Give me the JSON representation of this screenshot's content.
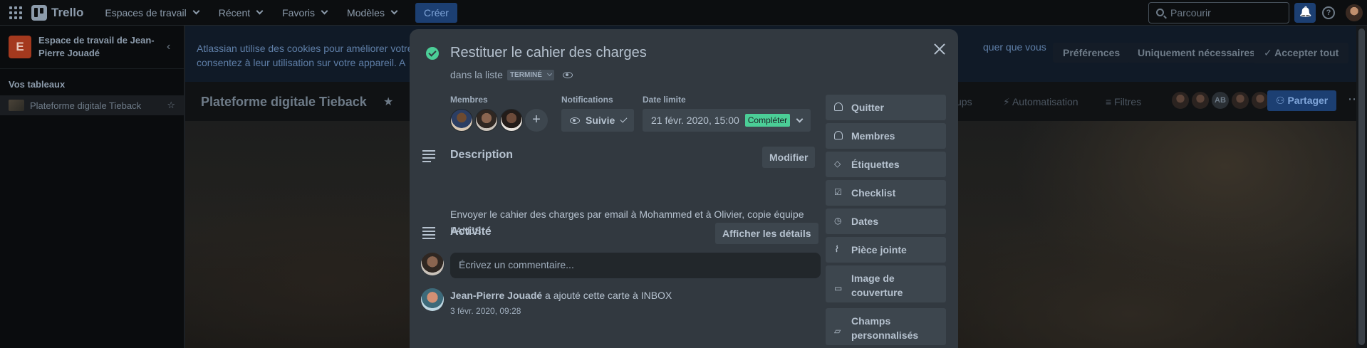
{
  "topnav": {
    "app_name": "Trello",
    "menu": [
      "Espaces de travail",
      "Récent",
      "Favoris",
      "Modèles"
    ],
    "create_label": "Créer",
    "search_placeholder": "Parcourir"
  },
  "sidebar": {
    "workspace_initial": "E",
    "workspace_name": "Espace de travail de Jean-Pierre Jouadé",
    "boards_heading": "Vos tableaux",
    "boards": [
      "Plateforme digitale Tieback"
    ]
  },
  "cookie_banner": {
    "text_left": "Atlassian utilise des cookies pour améliorer votre consentez à leur utilisation sur votre appareil. A",
    "text_right": "quer que vous",
    "preferences": "Préférences",
    "necessary_only": "Uniquement nécessaires",
    "accept_all": "Accepter tout"
  },
  "board": {
    "title": "Plateforme digitale Tieback",
    "items": [
      "ups",
      "Automatisation",
      "Filtres"
    ],
    "avatar_initials": "AB",
    "share_label": "Partager"
  },
  "card": {
    "title": "Restituer le cahier des charges",
    "in_list_prefix": "dans la liste",
    "list_name": "TERMINÉ",
    "members_label": "Membres",
    "notifications_label": "Notifications",
    "notifications_value": "Suivie",
    "due_label": "Date limite",
    "due_value": "21 févr. 2020, 15:00",
    "due_status": "Compléter",
    "description_title": "Description",
    "edit_label": "Modifier",
    "description_text": "Envoyer le cahier des charges par email à Mohammed et à Olivier, copie équipe FANJS",
    "activity_title": "Activité",
    "show_details": "Afficher les détails",
    "comment_placeholder": "Écrivez un commentaire...",
    "activity": {
      "author": "Jean-Pierre Jouadé",
      "action": " a ajouté cette carte à INBOX",
      "time": "3 févr. 2020, 09:28"
    }
  },
  "card_sidebar": {
    "buttons": [
      "Quitter",
      "Membres",
      "Étiquettes",
      "Checklist",
      "Dates",
      "Pièce jointe",
      "Image de couverture",
      "Champs personnalisés"
    ]
  }
}
